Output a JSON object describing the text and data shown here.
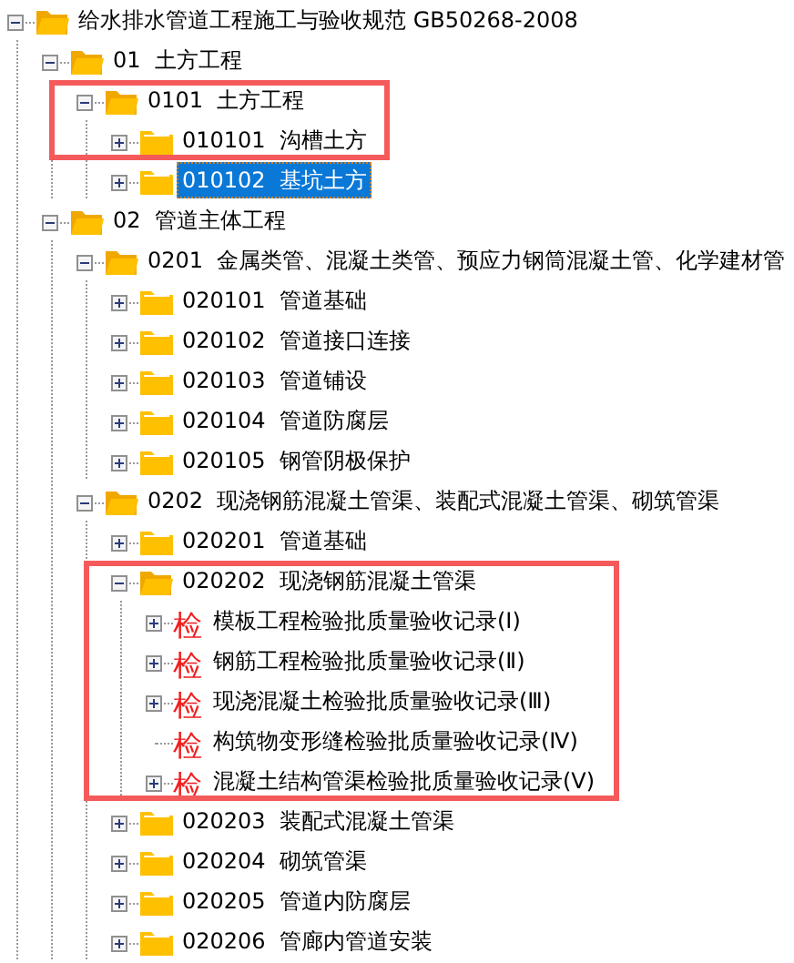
{
  "tree": [
    {
      "kind": "folder",
      "label": "给水排水管道工程施工与验收规范 GB50268-2008",
      "expandable": true,
      "expanded": true,
      "selected": false,
      "highlighted": false,
      "children": [
        {
          "kind": "folder",
          "label": "01  土方工程",
          "expandable": true,
          "expanded": true,
          "selected": false,
          "highlighted": false,
          "children": [
            {
              "kind": "folder",
              "label": "0101  土方工程",
              "expandable": true,
              "expanded": true,
              "selected": false,
              "highlighted": true,
              "children": [
                {
                  "kind": "folder",
                  "label": "010101  沟槽土方",
                  "expandable": true,
                  "expanded": false,
                  "selected": false,
                  "highlighted": true
                },
                {
                  "kind": "folder",
                  "label": "010102  基坑土方",
                  "expandable": true,
                  "expanded": false,
                  "selected": true,
                  "highlighted": false
                }
              ]
            }
          ]
        },
        {
          "kind": "folder",
          "label": "02  管道主体工程",
          "expandable": true,
          "expanded": true,
          "selected": false,
          "highlighted": false,
          "children": [
            {
              "kind": "folder",
              "label": "0201  金属类管、混凝土类管、预应力钢筒混凝土管、化学建材管",
              "expandable": true,
              "expanded": true,
              "selected": false,
              "highlighted": false,
              "children": [
                {
                  "kind": "folder",
                  "label": "020101  管道基础",
                  "expandable": true,
                  "expanded": false,
                  "selected": false,
                  "highlighted": false
                },
                {
                  "kind": "folder",
                  "label": "020102  管道接口连接",
                  "expandable": true,
                  "expanded": false,
                  "selected": false,
                  "highlighted": false
                },
                {
                  "kind": "folder",
                  "label": "020103  管道铺设",
                  "expandable": true,
                  "expanded": false,
                  "selected": false,
                  "highlighted": false
                },
                {
                  "kind": "folder",
                  "label": "020104  管道防腐层",
                  "expandable": true,
                  "expanded": false,
                  "selected": false,
                  "highlighted": false
                },
                {
                  "kind": "folder",
                  "label": "020105  钢管阴极保护",
                  "expandable": true,
                  "expanded": false,
                  "selected": false,
                  "highlighted": false
                }
              ]
            },
            {
              "kind": "folder",
              "label": "0202  现浇钢筋混凝土管渠、装配式混凝土管渠、砌筑管渠",
              "expandable": true,
              "expanded": true,
              "selected": false,
              "highlighted": false,
              "children": [
                {
                  "kind": "folder",
                  "label": "020201  管道基础",
                  "expandable": true,
                  "expanded": false,
                  "selected": false,
                  "highlighted": false
                },
                {
                  "kind": "folder",
                  "label": "020202  现浇钢筋混凝土管渠",
                  "expandable": true,
                  "expanded": true,
                  "selected": false,
                  "highlighted": true,
                  "children": [
                    {
                      "kind": "record",
                      "icon_text": "检",
                      "label": "模板工程检验批质量验收记录(Ⅰ)",
                      "expandable": true,
                      "selected": false,
                      "highlighted": true
                    },
                    {
                      "kind": "record",
                      "icon_text": "检",
                      "label": "钢筋工程检验批质量验收记录(Ⅱ)",
                      "expandable": true,
                      "selected": false,
                      "highlighted": true
                    },
                    {
                      "kind": "record",
                      "icon_text": "检",
                      "label": "现浇混凝土检验批质量验收记录(Ⅲ)",
                      "expandable": true,
                      "selected": false,
                      "highlighted": true
                    },
                    {
                      "kind": "record",
                      "icon_text": "检",
                      "label": "构筑物变形缝检验批质量验收记录(Ⅳ)",
                      "expandable": false,
                      "selected": false,
                      "highlighted": true
                    },
                    {
                      "kind": "record",
                      "icon_text": "检",
                      "label": "混凝土结构管渠检验批质量验收记录(Ⅴ)",
                      "expandable": true,
                      "selected": false,
                      "highlighted": true
                    }
                  ]
                },
                {
                  "kind": "folder",
                  "label": "020203  装配式混凝土管渠",
                  "expandable": true,
                  "expanded": false,
                  "selected": false,
                  "highlighted": false
                },
                {
                  "kind": "folder",
                  "label": "020204  砌筑管渠",
                  "expandable": true,
                  "expanded": false,
                  "selected": false,
                  "highlighted": false
                },
                {
                  "kind": "folder",
                  "label": "020205  管道内防腐层",
                  "expandable": true,
                  "expanded": false,
                  "selected": false,
                  "highlighted": false
                },
                {
                  "kind": "folder",
                  "label": "020206  管廊内管道安装",
                  "expandable": true,
                  "expanded": false,
                  "selected": false,
                  "highlighted": false
                }
              ]
            }
          ]
        }
      ]
    }
  ]
}
